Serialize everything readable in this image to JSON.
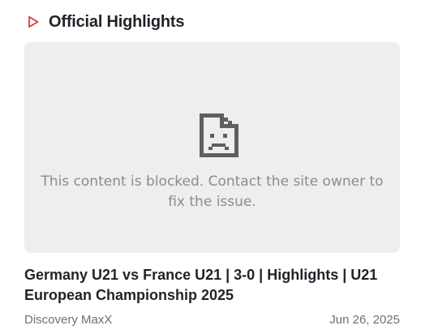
{
  "section": {
    "title": "Official Highlights",
    "icon": "play-outline-icon",
    "accent_color": "#e03a3a"
  },
  "embed": {
    "icon": "broken-page-icon",
    "message": "This content is blocked. Contact the site owner to fix the issue."
  },
  "video": {
    "title": "Germany U21 vs France U21 | 3-0 | Highlights | U21 European Championship 2025",
    "channel": "Discovery MaxX",
    "date": "Jun 26, 2025"
  }
}
